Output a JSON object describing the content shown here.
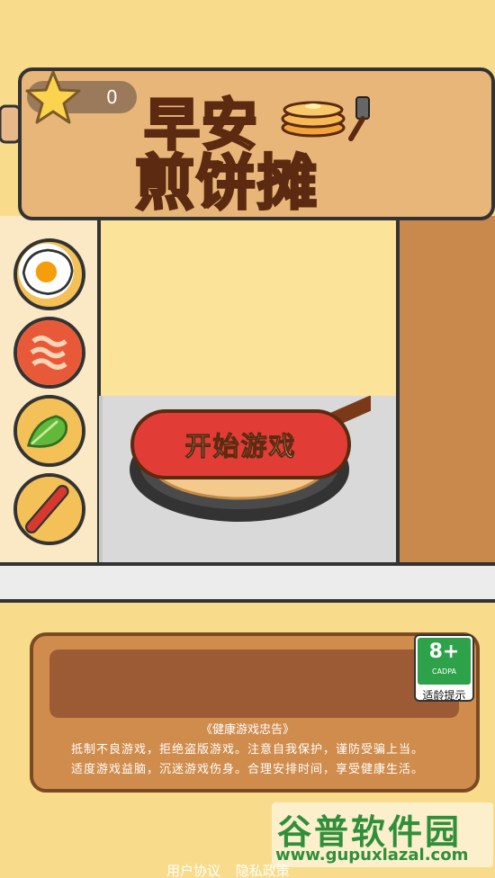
{
  "game": {
    "title_line1": "早安",
    "title_line2": "煎饼摊",
    "score": "0",
    "start_button": "开始游戏"
  },
  "ingredients": [
    {
      "name": "egg"
    },
    {
      "name": "bacon"
    },
    {
      "name": "lettuce"
    },
    {
      "name": "sausage"
    }
  ],
  "notice": {
    "title": "《健康游戏忠告》",
    "line1": "抵制不良游戏，拒绝盗版游戏。注意自我保护，谨防受骗上当。",
    "line2": "适度游戏益脑，沉迷游戏伤身。合理安排时间，享受健康生活。"
  },
  "age_rating": {
    "value": "8+",
    "org": "CADPA",
    "label": "适龄提示"
  },
  "footer": {
    "user_agreement": "用户协议",
    "privacy": "隐私政策"
  },
  "watermark": {
    "name": "谷普软件园",
    "url": "www.gupuxlazal.com"
  },
  "colors": {
    "background": "#f8dc8c",
    "sign": "#e8b679",
    "title": "#f7a130",
    "button": "#e13d36",
    "badge_green": "#2ea24a"
  }
}
